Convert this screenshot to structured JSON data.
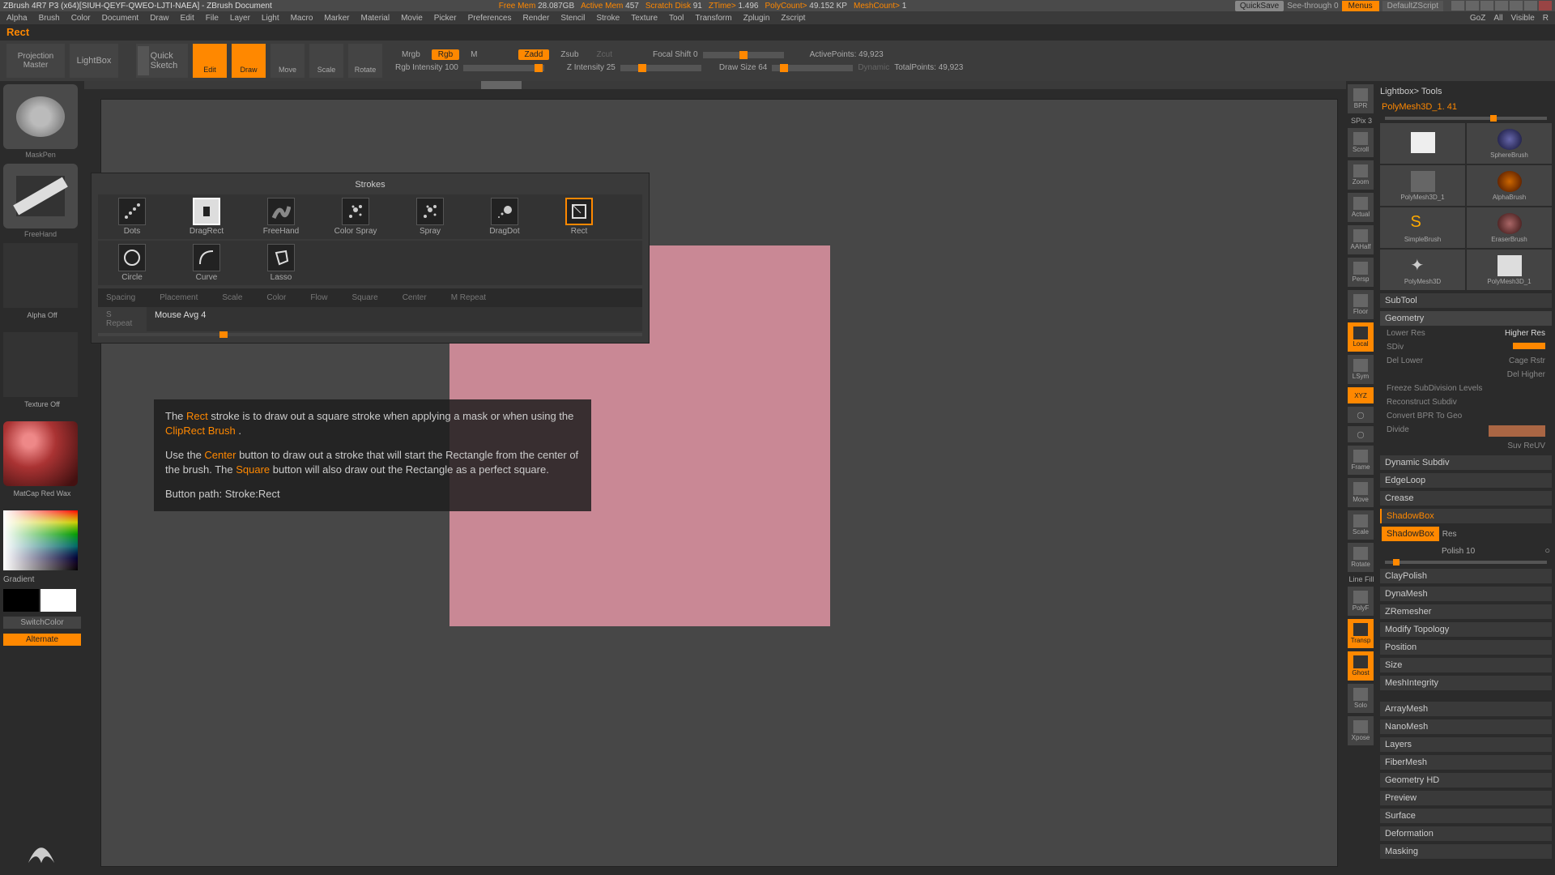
{
  "title_bar": "ZBrush 4R7 P3 (x64)[SIUH-QEYF-QWEO-LJTI-NAEA] - ZBrush Document",
  "stats": {
    "freemem_lbl": "Free Mem",
    "freemem": "28.087GB",
    "activemem_lbl": "Active Mem",
    "activemem": "457",
    "scratch_lbl": "Scratch Disk",
    "scratch": "91",
    "ztime_lbl": "ZTime>",
    "ztime": "1.496",
    "polycount_lbl": "PolyCount>",
    "polycount": "49.152 KP",
    "meshcount_lbl": "MeshCount>",
    "meshcount": "1"
  },
  "top_right": {
    "quicksave": "QuickSave",
    "seethrough": "See-through  0",
    "menus": "Menus",
    "script": "DefaultZScript"
  },
  "menus": [
    "Alpha",
    "Brush",
    "Color",
    "Document",
    "Draw",
    "Edit",
    "File",
    "Layer",
    "Light",
    "Macro",
    "Marker",
    "Material",
    "Movie",
    "Picker",
    "Preferences",
    "Render",
    "Stencil",
    "Stroke",
    "Texture",
    "Tool",
    "Transform",
    "Zplugin",
    "Zscript"
  ],
  "right_tabs": [
    "GoZ",
    "All",
    "Visible",
    "R"
  ],
  "info_label": "Rect",
  "toolbar": {
    "projection": "Projection\nMaster",
    "lightbox": "LightBox",
    "sketch": "Quick\nSketch",
    "modes": {
      "edit": "Edit",
      "draw": "Draw",
      "move": "Move",
      "scale": "Scale",
      "rotate": "Rotate"
    },
    "mrgb": "Mrgb",
    "rgb": "Rgb",
    "m": "M",
    "rgb_int": "Rgb Intensity 100",
    "zadd": "Zadd",
    "zsub": "Zsub",
    "zcut": "Zcut",
    "zint": "Z Intensity 25",
    "focal": "Focal Shift 0",
    "draw_size": "Draw Size 64",
    "dynamic": "Dynamic",
    "active_pts": "ActivePoints: 49,923",
    "total_pts": "TotalPoints: 49,923"
  },
  "left": {
    "brush": "MaskPen",
    "stroke": "FreeHand",
    "alpha": "Alpha Off",
    "texture": "Texture Off",
    "material": "MatCap Red Wax",
    "gradient": "Gradient",
    "switchcolor": "SwitchColor",
    "alternate": "Alternate"
  },
  "strokes": {
    "title": "Strokes",
    "items": [
      "Dots",
      "DragRect",
      "FreeHand",
      "Color Spray",
      "Spray",
      "DragDot",
      "Rect"
    ],
    "items2": [
      "Circle",
      "Curve",
      "Lasso"
    ],
    "sliders": [
      "Spacing",
      "Placement",
      "Scale",
      "Color",
      "Flow",
      "Square",
      "Center",
      "M Repeat",
      "S Repeat"
    ],
    "mouse": "Mouse Avg 4"
  },
  "tooltip": {
    "p1a": "The ",
    "p1b": "Rect",
    "p1c": " stroke is to draw out a square stroke when applying a mask or when using the ",
    "p1d": "ClipRect Brush",
    "p1e": " .",
    "p2a": "Use the ",
    "p2b": "Center",
    "p2c": " button to draw out a stroke that will start the Rectangle from the center of the brush. The ",
    "p2d": "Square",
    "p2e": " button will also draw out the Rectangle as a perfect square.",
    "p3": "Button path: Stroke:Rect"
  },
  "rightbar": [
    "BPR",
    "SPix 3",
    "Scroll",
    "Zoom",
    "Actual",
    "AAHalf",
    "Persp",
    "Floor",
    "Local",
    "LSym",
    "XYZ",
    "",
    "",
    "Frame",
    "Move",
    "Scale",
    "Rotate",
    "Line Fill",
    "PolyF",
    "Transp",
    "Ghost",
    "Solo",
    "Xpose"
  ],
  "rightpanel": {
    "lightbox": "Lightbox> Tools",
    "tool": "PolyMesh3D_1. 41",
    "tiles": [
      "",
      "SphereBrush",
      "PolyMesh3D_1",
      "AlphaBrush",
      "SimpleBrush",
      "EraserBrush",
      "PolyMesh3D",
      "PolyMesh3D_1"
    ],
    "subtool": "SubTool",
    "geometry": "Geometry",
    "geo_items": [
      [
        "Lower Res",
        "Higher Res"
      ],
      [
        "SDiv",
        ""
      ],
      [
        "Del Lower",
        "Cage   Rstr"
      ],
      [
        "",
        "Del Higher"
      ],
      [
        "Freeze SubDivision Levels",
        ""
      ],
      [
        "Reconstruct Subdiv",
        ""
      ],
      [
        "Convert BPR To Geo",
        ""
      ],
      [
        "Divide",
        ""
      ],
      [
        "",
        "Suv     ReUV"
      ]
    ],
    "sections": [
      "Dynamic Subdiv",
      "EdgeLoop",
      "Crease",
      "ShadowBox"
    ],
    "shadowbox": {
      "btn": "ShadowBox",
      "res": "Res",
      "polish": "Polish 10"
    },
    "sections2": [
      "ClayPolish",
      "DynaMesh",
      "ZRemesher",
      "Modify Topology",
      "Position",
      "Size",
      "MeshIntegrity",
      "ArrayMesh",
      "NanoMesh",
      "Layers",
      "FiberMesh",
      "Geometry HD",
      "Preview",
      "Surface",
      "Deformation",
      "Masking"
    ]
  },
  "chart_data": null
}
